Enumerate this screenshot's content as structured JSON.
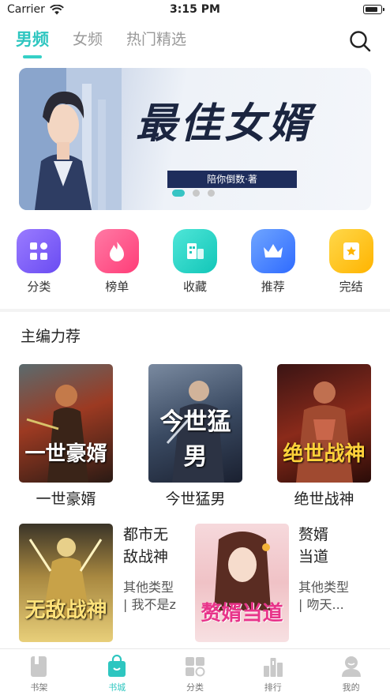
{
  "status": {
    "carrier": "Carrier",
    "time": "3:15 PM"
  },
  "tabs": [
    {
      "label": "男频",
      "active": true
    },
    {
      "label": "女频",
      "active": false
    },
    {
      "label": "热门精选",
      "active": false
    }
  ],
  "banner": {
    "title": "最佳女婿",
    "author": "陪你倒数·著",
    "page_count": 3,
    "current_page": 1
  },
  "categories": [
    {
      "label": "分类",
      "icon": "grid-icon",
      "color": "#7b61ff"
    },
    {
      "label": "榜单",
      "icon": "flame-icon",
      "color": "#ff4f8b"
    },
    {
      "label": "收藏",
      "icon": "building-icon",
      "color": "#1fd3c6"
    },
    {
      "label": "推荐",
      "icon": "crown-icon",
      "color": "#3d7dff"
    },
    {
      "label": "完结",
      "icon": "book-star-icon",
      "color": "#ffc21a"
    }
  ],
  "section": {
    "title": "主编力荐"
  },
  "books_row1": [
    {
      "name": "一世豪婿",
      "cover_text": "一世豪婿"
    },
    {
      "name": "今世猛男",
      "cover_text": "今世猛男"
    },
    {
      "name": "绝世战神",
      "cover_text": "绝世战神"
    }
  ],
  "books_row2": [
    {
      "title": "都市无敌战神",
      "title_l1": "都市无",
      "title_l2": "敌战神",
      "sub_l1": "其他类型",
      "sub_l2": "| 我不是z",
      "cover_text": "无敌战神"
    },
    {
      "title": "赘婿当道",
      "title_l1": "赘婿",
      "title_l2": "当道",
      "sub_l1": "其他类型",
      "sub_l2": "| 吻天...",
      "cover_text": "赘婿当道"
    }
  ],
  "tabbar": [
    {
      "label": "书架",
      "active": false,
      "icon": "bookshelf-icon"
    },
    {
      "label": "书城",
      "active": true,
      "icon": "shopping-bag-icon"
    },
    {
      "label": "分类",
      "active": false,
      "icon": "category-grid-icon"
    },
    {
      "label": "排行",
      "active": false,
      "icon": "ranking-icon"
    },
    {
      "label": "我的",
      "active": false,
      "icon": "profile-icon"
    }
  ],
  "accent_color": "#2ec6c0"
}
